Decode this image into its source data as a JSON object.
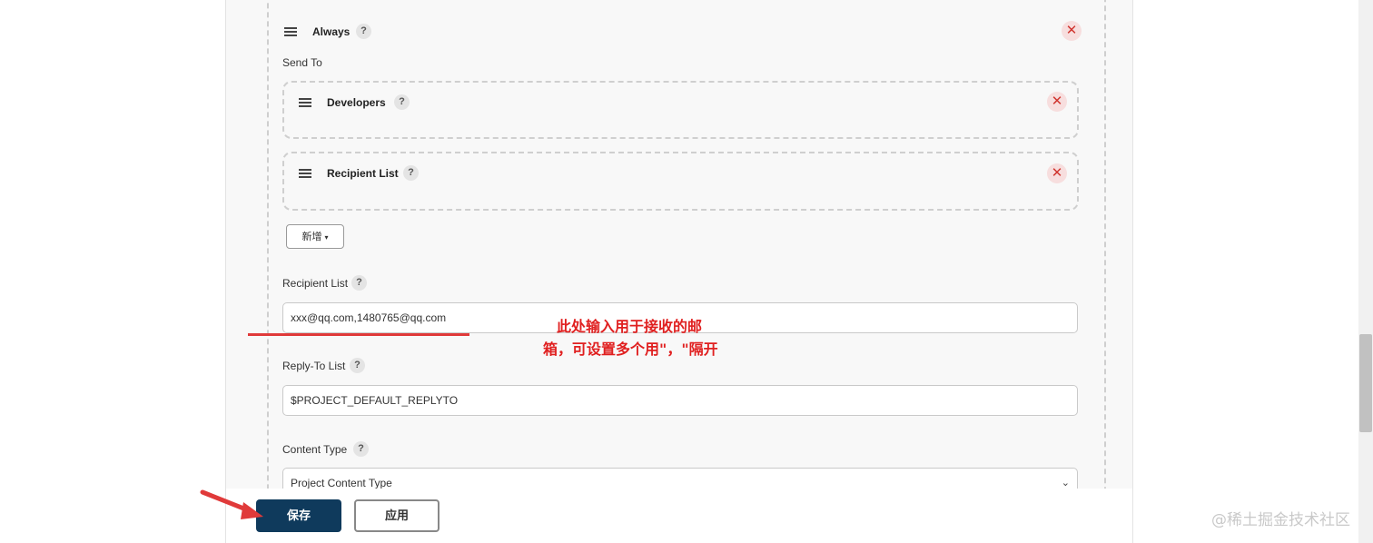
{
  "always_section": {
    "title": "Always",
    "help": "?",
    "remove": "✕"
  },
  "send_to": {
    "label": "Send To",
    "developers": {
      "title": "Developers",
      "help": "?",
      "remove": "✕"
    },
    "recipient_list_item": {
      "title": "Recipient List",
      "help": "?",
      "remove": "✕"
    },
    "add_button": {
      "label": "新增",
      "caret": "▾"
    }
  },
  "recipient_list": {
    "label": "Recipient List",
    "help": "?",
    "value": "xxx@qq.com,1480765@qq.com"
  },
  "reply_to_list": {
    "label": "Reply-To List",
    "help": "?",
    "value": "$PROJECT_DEFAULT_REPLYTO"
  },
  "content_type": {
    "label": "Content Type",
    "help": "?",
    "selected": "Project Content Type"
  },
  "footer": {
    "save_label": "保存",
    "apply_label": "应用"
  },
  "annotation": {
    "line1": "此处输入用于接收的邮",
    "line2": "箱，可设置多个用\"，\"隔开",
    "color": "#e02020"
  },
  "watermark": "@稀土掘金技术社区"
}
